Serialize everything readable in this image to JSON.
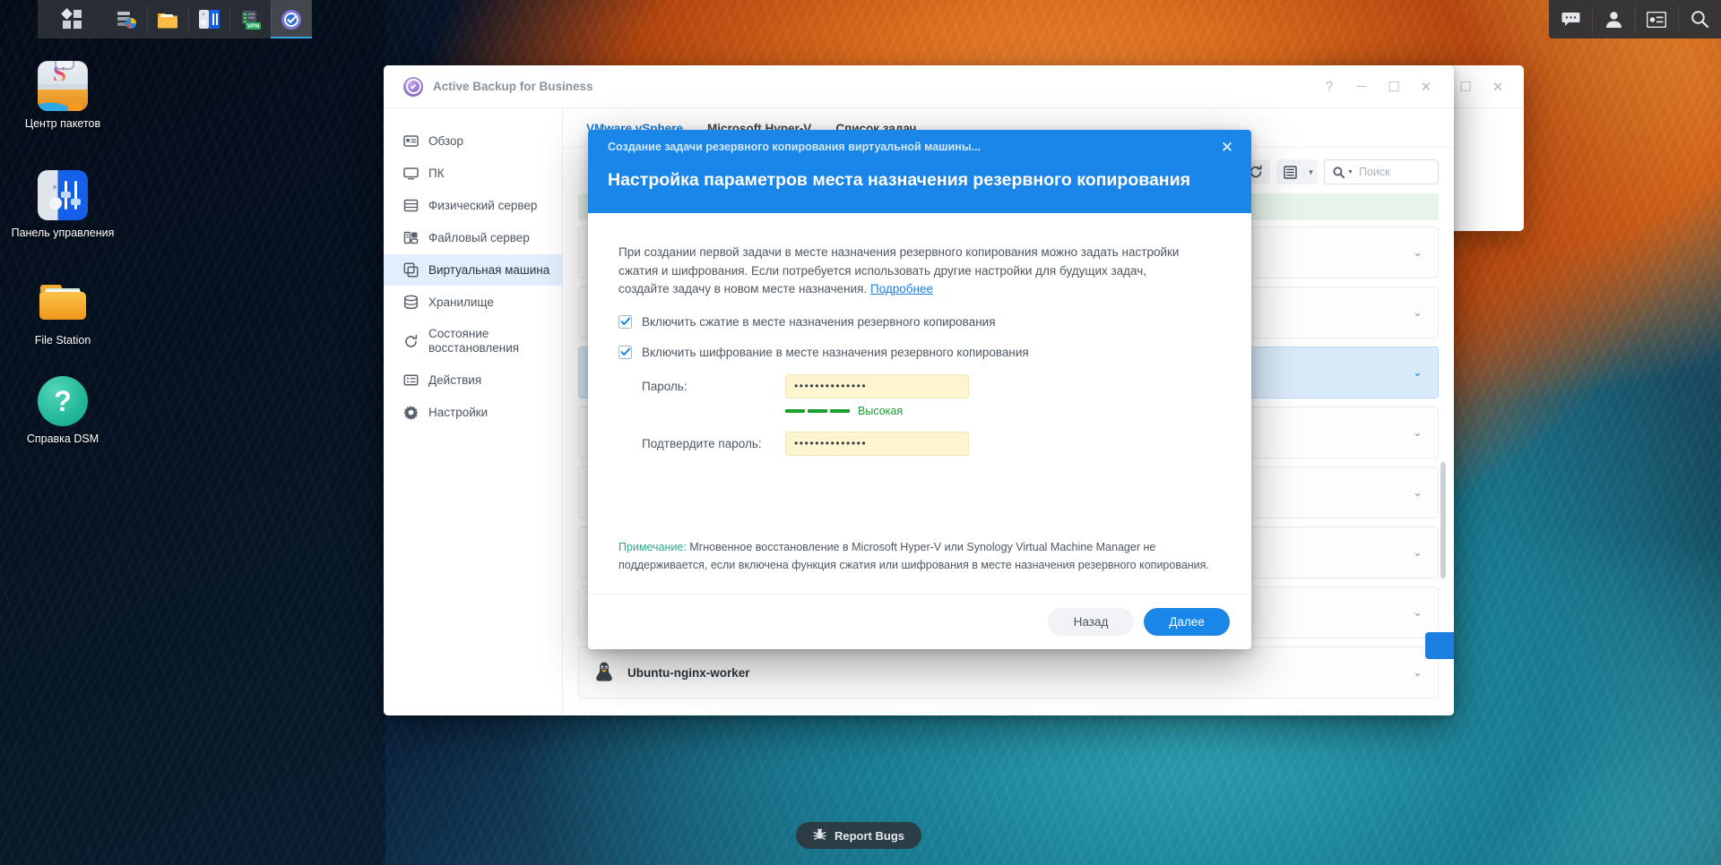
{
  "taskbar": {
    "start_icon": "apps-grid-icon",
    "apps": [
      {
        "name": "storage-manager-icon",
        "active": false
      },
      {
        "name": "file-station-icon",
        "active": false
      },
      {
        "name": "control-panel-icon",
        "active": false
      },
      {
        "name": "vpn-server-icon",
        "active": false
      },
      {
        "name": "active-backup-icon",
        "active": true
      }
    ],
    "tray": [
      "notifications-icon",
      "user-account-icon",
      "widgets-icon",
      "search-icon"
    ]
  },
  "desktop": {
    "icons": [
      {
        "label": "Центр\nпакетов",
        "icon": "package-center-icon"
      },
      {
        "label": "Панель управления",
        "icon": "control-panel-icon"
      },
      {
        "label": "File Station",
        "icon": "file-station-icon"
      },
      {
        "label": "Справка DSM",
        "icon": "dsm-help-icon"
      }
    ]
  },
  "window": {
    "title": "Active Backup for Business",
    "controls": {
      "help": "?",
      "minimize": "─",
      "maximize": "☐",
      "close": "✕"
    }
  },
  "sidebar": {
    "items": [
      {
        "label": "Обзор",
        "icon": "overview-icon",
        "selected": false
      },
      {
        "label": "ПК",
        "icon": "pc-icon",
        "selected": false
      },
      {
        "label": "Физический сервер",
        "icon": "physical-server-icon",
        "selected": false
      },
      {
        "label": "Файловый сервер",
        "icon": "file-server-icon",
        "selected": false
      },
      {
        "label": "Виртуальная машина",
        "icon": "virtual-machine-icon",
        "selected": true
      },
      {
        "label": "Хранилище",
        "icon": "storage-icon",
        "selected": false
      },
      {
        "label": "Состояние\nвосстановления",
        "icon": "restore-status-icon",
        "selected": false
      },
      {
        "label": "Действия",
        "icon": "activities-icon",
        "selected": false
      },
      {
        "label": "Настройки",
        "icon": "settings-gear-icon",
        "selected": false
      }
    ]
  },
  "main": {
    "tabs": [
      {
        "label": "VMware vSphere",
        "active": true
      },
      {
        "label": "Microsoft Hyper-V",
        "active": false
      },
      {
        "label": "Список задач",
        "active": false
      }
    ],
    "toolbar": {
      "refresh_icon": "refresh-icon",
      "view_icon": "list-view-icon",
      "caret_icon": "chevron-down-icon"
    },
    "search": {
      "placeholder": "Поиск",
      "value": "",
      "icon": "search-icon"
    },
    "vm_rows": [
      {
        "name": "Ubuntu-nginx-worker",
        "os_icon": "linux-penguin-icon"
      }
    ]
  },
  "dialog": {
    "subtitle": "Создание задачи резервного копирования виртуальной машины...",
    "title": "Настройка параметров места назначения резервного копирования",
    "close_icon": "close-icon",
    "description": "При создании первой задачи в месте назначения резервного копирования можно задать настройки сжатия и шифрования. Если потребуется использовать другие настройки для будущих задач, создайте задачу в новом месте назначения. ",
    "description_link": "Подробнее",
    "checkbox_compression": {
      "label": "Включить сжатие в месте назначения резервного копирования",
      "checked": true
    },
    "checkbox_encryption": {
      "label": "Включить шифрование в месте назначения резервного копирования",
      "checked": true
    },
    "password_label": "Пароль:",
    "password_value": "••••••••••••••",
    "password_strength_label": "Высокая",
    "password_strength_segments": 3,
    "password_strength_color": "#1a9f2e",
    "confirm_label": "Подтвердите пароль:",
    "confirm_value": "••••••••••••••",
    "note_lead": "Примечание:",
    "note_text": " Мгновенное восстановление в Microsoft Hyper-V или Synology Virtual Machine Manager не поддерживается, если включена функция сжатия или шифрования в месте назначения резервного копирования.",
    "back_button": "Назад",
    "next_button": "Далее",
    "accent_color": "#1a86e8"
  },
  "report_bugs": {
    "label": "Report Bugs",
    "icon": "bug-icon"
  }
}
